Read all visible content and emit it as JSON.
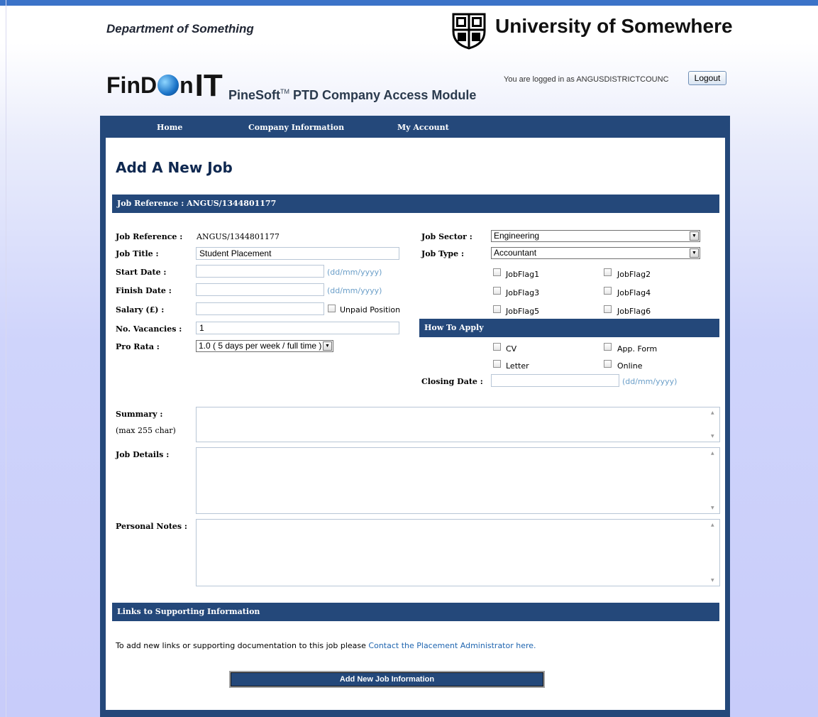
{
  "header": {
    "department": "Department of Something",
    "university": "University of Somewhere",
    "logo_text_a": "FinD",
    "logo_text_b": "n",
    "logo_text_c": "IT",
    "module_name": "PineSoft",
    "module_tm": "TM",
    "module_suffix": " PTD Company Access Module",
    "logged_in_text": "You are logged in as ANGUSDISTRICTCOUNC",
    "logout_label": "Logout"
  },
  "nav": {
    "items": [
      "Home",
      "Company Information",
      "My Account"
    ]
  },
  "page": {
    "title": "Add A New Job",
    "section_bar": "Job Reference : ANGUS/1344801177"
  },
  "form": {
    "job_reference_label": "Job Reference :",
    "job_reference_value": "ANGUS/1344801177",
    "job_title_label": "Job Title :",
    "job_title_value": "Student Placement",
    "start_date_label": "Start Date :",
    "start_date_value": "",
    "finish_date_label": "Finish Date :",
    "finish_date_value": "",
    "date_hint": "(dd/mm/yyyy)",
    "salary_label": "Salary (£) :",
    "salary_value": "",
    "unpaid_label": "Unpaid Position",
    "vacancies_label": "No. Vacancies :",
    "vacancies_value": "1",
    "pro_rata_label": "Pro Rata :",
    "pro_rata_value": "1.0 ( 5 days per week / full time )",
    "job_sector_label": "Job Sector :",
    "job_sector_value": "Engineering",
    "job_type_label": "Job Type :",
    "job_type_value": "Accountant",
    "flags": [
      "JobFlag1",
      "JobFlag2",
      "JobFlag3",
      "JobFlag4",
      "JobFlag5",
      "JobFlag6"
    ],
    "how_to_apply_bar": "How To Apply",
    "apply_options": [
      "CV",
      "App. Form",
      "Letter",
      "Online"
    ],
    "closing_date_label": "Closing Date :",
    "closing_date_value": "",
    "summary_label": "Summary :",
    "summary_hint": "(max 255 char)",
    "job_details_label": "Job Details :",
    "personal_notes_label": "Personal Notes :"
  },
  "links": {
    "bar": "Links to Supporting Information",
    "text": "To add new links or supporting documentation to this job please ",
    "link": "Contact the Placement Administrator here."
  },
  "submit_label": "Add New Job Information"
}
